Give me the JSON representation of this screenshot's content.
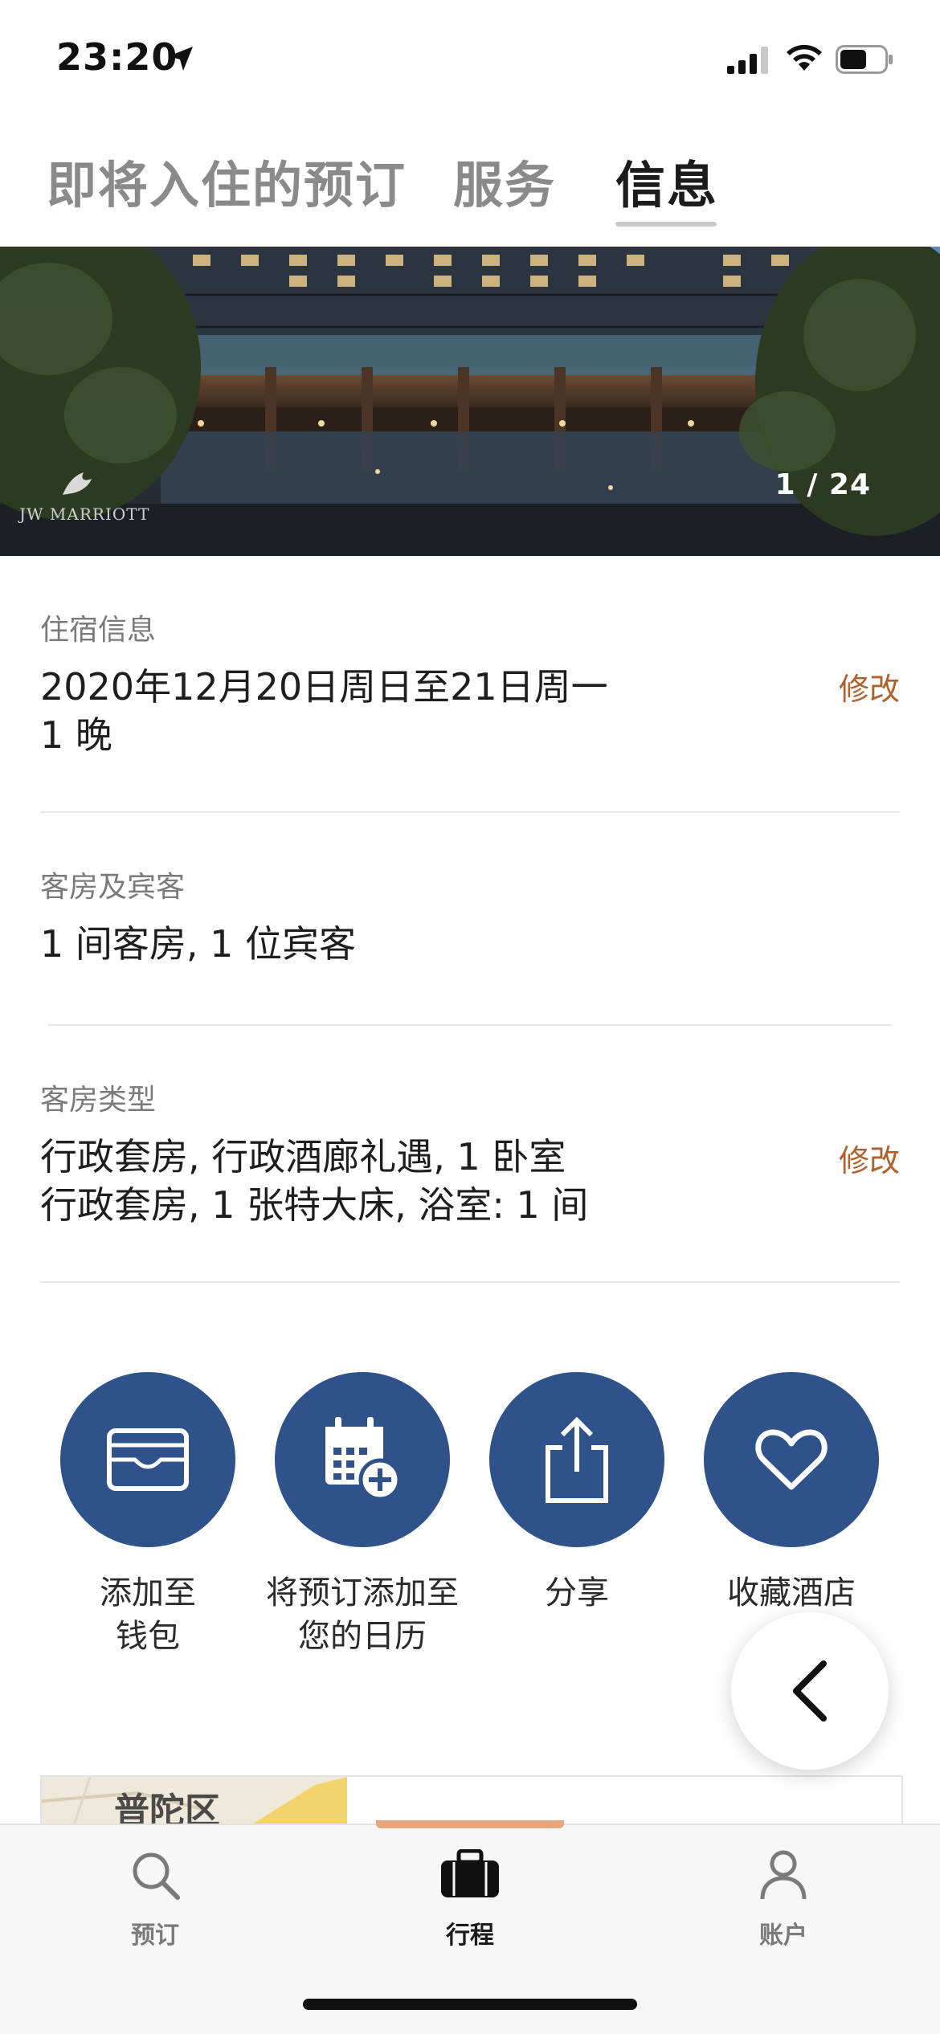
{
  "status_bar": {
    "time": "23:20",
    "icons": [
      "location-arrow-icon",
      "cellular-signal-icon",
      "wifi-icon",
      "battery-icon"
    ]
  },
  "top_tabs": [
    {
      "label": "即将入住的预订",
      "active": false
    },
    {
      "label": "服务",
      "active": false
    },
    {
      "label": "信息",
      "active": true
    }
  ],
  "hero": {
    "counter": "1 / 24",
    "brand_text": "JW MARRIOTT"
  },
  "stay_info": {
    "label": "住宿信息",
    "dates": "2020年12月20日周日至21日周一",
    "nights": "1 晚",
    "edit_label": "修改"
  },
  "rooms_guests": {
    "label": "客房及宾客",
    "value": "1 间客房, 1 位宾客"
  },
  "room_type": {
    "label": "客房类型",
    "line1": "行政套房, 行政酒廊礼遇, 1 卧室",
    "line2": "行政套房, 1  张特大床, 浴室: 1 间",
    "edit_label": "修改"
  },
  "actions": [
    {
      "line1": "添加至",
      "line2": "钱包",
      "icon": "wallet-icon"
    },
    {
      "line1": "将预订添加至",
      "line2": "您的日历",
      "icon": "calendar-add-icon"
    },
    {
      "line1": "分享",
      "line2": "",
      "icon": "share-icon"
    },
    {
      "line1": "收藏酒店",
      "line2": "",
      "icon": "heart-icon"
    }
  ],
  "map": {
    "district_label": "普陀区"
  },
  "bottom_tabs": [
    {
      "label": "预订",
      "icon": "search-icon",
      "active": false
    },
    {
      "label": "行程",
      "icon": "suitcase-icon",
      "active": true
    },
    {
      "label": "账户",
      "icon": "person-icon",
      "active": false
    }
  ],
  "colors": {
    "accent_blue": "#2e5289",
    "edit_orange": "#b0602c",
    "tab_indicator": "#e8a47a"
  }
}
